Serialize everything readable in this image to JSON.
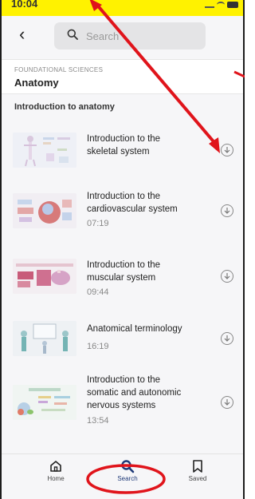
{
  "status": {
    "time": "10:04"
  },
  "header": {
    "back_glyph": "‹",
    "search_placeholder": "Search"
  },
  "category": {
    "kicker": "FOUNDATIONAL SCIENCES",
    "title": "Anatomy"
  },
  "section": {
    "title": "Introduction to anatomy"
  },
  "items": [
    {
      "title_line1": "Introduction to the",
      "title_line2": "skeletal system",
      "title_line3": "",
      "duration": ""
    },
    {
      "title_line1": "Introduction to the",
      "title_line2": "cardiovascular system",
      "title_line3": "",
      "duration": "07:19"
    },
    {
      "title_line1": "Introduction to the",
      "title_line2": "muscular system",
      "title_line3": "",
      "duration": "09:44"
    },
    {
      "title_line1": "Anatomical terminology",
      "title_line2": "",
      "title_line3": "",
      "duration": "16:19"
    },
    {
      "title_line1": "Introduction to the",
      "title_line2": "somatic and autonomic",
      "title_line3": "nervous systems",
      "duration": "13:54"
    }
  ],
  "tabs": [
    {
      "label": "Home",
      "icon": "home-icon"
    },
    {
      "label": "Search",
      "icon": "search-icon"
    },
    {
      "label": "Saved",
      "icon": "bookmark-icon"
    }
  ],
  "colors": {
    "highlight": "#fff200",
    "annotation_red": "#e0141b",
    "accent": "#1f3a78"
  }
}
